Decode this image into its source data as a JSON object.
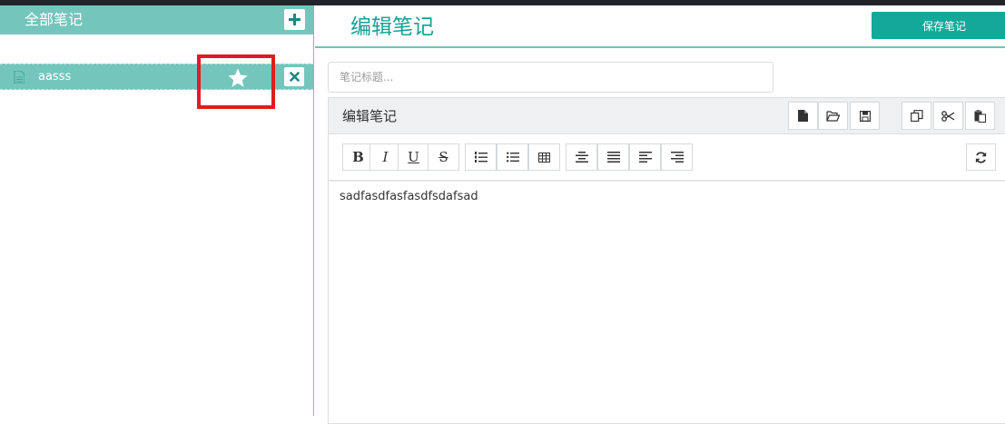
{
  "sidebar": {
    "title": "全部笔记",
    "notes": [
      {
        "label": "aasss",
        "favorite": true
      }
    ]
  },
  "main": {
    "title": "编辑笔记",
    "save_label": "保存笔记",
    "title_input": {
      "placeholder": "笔记标题...",
      "value": ""
    }
  },
  "editor": {
    "header_title": "编辑笔记",
    "content": "sadfasdfasfasdfsdafsad"
  },
  "toolbar": {
    "bold": "B",
    "italic": "I",
    "underline": "U",
    "strike": "S"
  },
  "icons": {
    "add": "plus-icon",
    "close": "close-icon",
    "star": "star-icon",
    "file": "file-icon"
  },
  "colors": {
    "accent": "#74c6bd",
    "accent_dark": "#14a89a",
    "highlight": "#e01b23"
  }
}
